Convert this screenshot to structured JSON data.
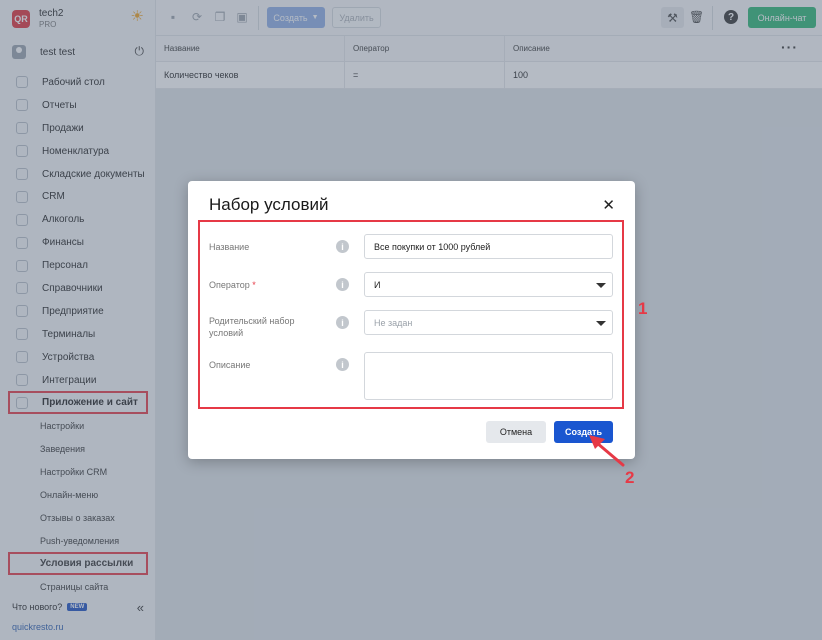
{
  "brand": {
    "logo": "QR",
    "name": "tech2",
    "plan": "PRO"
  },
  "user": {
    "name": "test test"
  },
  "sidebar": {
    "items": [
      {
        "label": "Рабочий стол"
      },
      {
        "label": "Отчеты"
      },
      {
        "label": "Продажи"
      },
      {
        "label": "Номенклатура"
      },
      {
        "label": "Складские документы"
      },
      {
        "label": "CRM"
      },
      {
        "label": "Алкоголь"
      },
      {
        "label": "Финансы"
      },
      {
        "label": "Персонал"
      },
      {
        "label": "Справочники"
      },
      {
        "label": "Предприятие"
      },
      {
        "label": "Терминалы"
      },
      {
        "label": "Устройства"
      },
      {
        "label": "Интеграции"
      },
      {
        "label": "Приложение и сайт"
      }
    ],
    "subitems": [
      {
        "label": "Настройки"
      },
      {
        "label": "Заведения"
      },
      {
        "label": "Настройки CRM"
      },
      {
        "label": "Онлайн-меню"
      },
      {
        "label": "Отзывы о заказах"
      },
      {
        "label": "Push-уведомления"
      },
      {
        "label": "Условия рассылки"
      },
      {
        "label": "Страницы сайта"
      }
    ],
    "whats_new": "Что нового?",
    "new_badge": "NEW",
    "footer_link": "quickresto.ru"
  },
  "toolbar": {
    "create_label": "Создать",
    "delete_label": "Удалить",
    "chat_label": "Онлайн-чат",
    "help_label": "?"
  },
  "table": {
    "columns": [
      "Название",
      "Оператор",
      "Описание"
    ],
    "rows": [
      {
        "name": "Количество чеков",
        "operator": "=",
        "description": "100"
      }
    ]
  },
  "modal": {
    "title": "Набор условий",
    "fields": {
      "name": {
        "label": "Название",
        "value": "Все покупки от 1000 рублей"
      },
      "operator": {
        "label": "Оператор",
        "required_mark": "*",
        "value": "И"
      },
      "parent": {
        "label": "Родительский набор условий",
        "placeholder": "Не задан"
      },
      "description": {
        "label": "Описание",
        "value": ""
      }
    },
    "cancel_label": "Отмена",
    "create_label": "Создать"
  },
  "annotations": {
    "box_number": "1",
    "arrow_number": "2"
  },
  "colors": {
    "accent": "#1a56d0",
    "highlight": "#e63946",
    "chat": "#2bb673",
    "brand": "#e0303a"
  }
}
